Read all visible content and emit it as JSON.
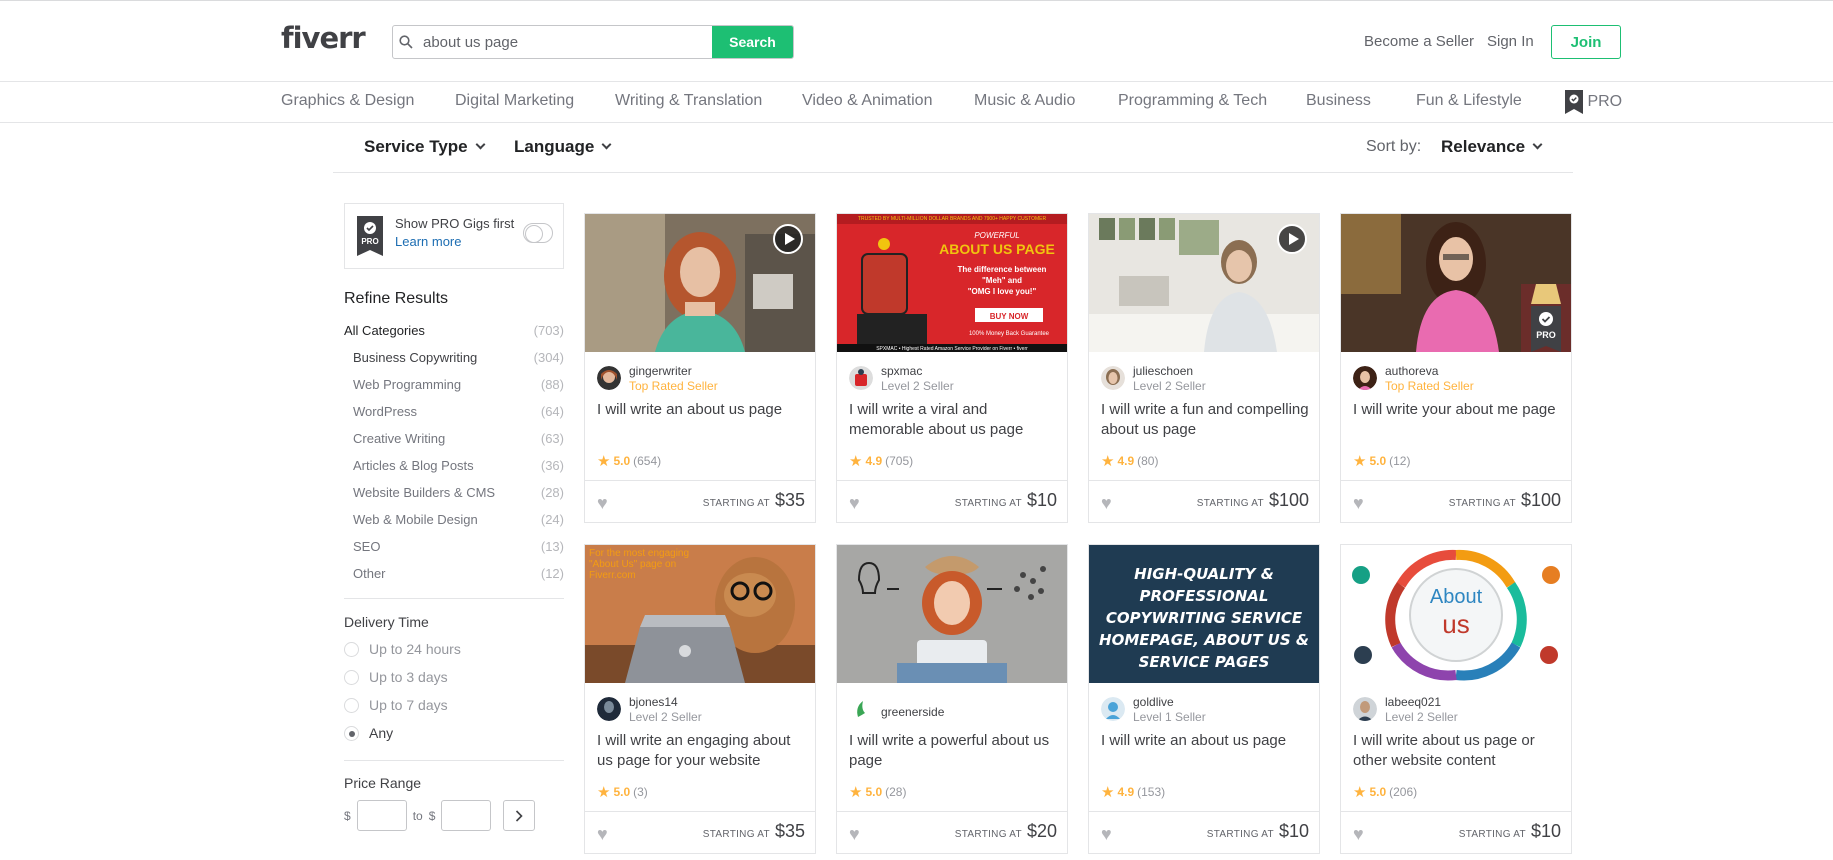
{
  "header": {
    "logo": "fiverr",
    "search_value": "about us page",
    "search_button": "Search",
    "become_seller": "Become a Seller",
    "sign_in": "Sign In",
    "join": "Join"
  },
  "categories": [
    "Graphics & Design",
    "Digital Marketing",
    "Writing & Translation",
    "Video & Animation",
    "Music & Audio",
    "Programming & Tech",
    "Business",
    "Fun & Lifestyle",
    "PRO"
  ],
  "filters": {
    "service_type": "Service Type",
    "language": "Language",
    "sort_label": "Sort by:",
    "sort_value": "Relevance"
  },
  "sidebar": {
    "pro_box": {
      "title": "Show PRO Gigs first",
      "link": "Learn more",
      "badge": "PRO"
    },
    "refine_title": "Refine Results",
    "all_categories": {
      "label": "All Categories",
      "count": "(703)"
    },
    "subcategories": [
      {
        "label": "Business Copywriting",
        "count": "(304)"
      },
      {
        "label": "Web Programming",
        "count": "(88)"
      },
      {
        "label": "WordPress",
        "count": "(64)"
      },
      {
        "label": "Creative Writing",
        "count": "(63)"
      },
      {
        "label": "Articles & Blog Posts",
        "count": "(36)"
      },
      {
        "label": "Website Builders & CMS",
        "count": "(28)"
      },
      {
        "label": "Web & Mobile Design",
        "count": "(24)"
      },
      {
        "label": "SEO",
        "count": "(13)"
      },
      {
        "label": "Other",
        "count": "(12)"
      }
    ],
    "delivery_title": "Delivery Time",
    "delivery_options": [
      "Up to 24 hours",
      "Up to 3 days",
      "Up to 7 days",
      "Any"
    ],
    "delivery_selected": "Any",
    "price_title": "Price Range",
    "price_from_symbol": "$",
    "price_to_label": "to",
    "price_to_symbol": "$"
  },
  "gigs": [
    {
      "seller": "gingerwriter",
      "level": "Top Rated Seller",
      "title": "I will write an about us page",
      "rating": "5.0",
      "reviews": "(654)",
      "price_label": "STARTING AT",
      "price": "$35"
    },
    {
      "seller": "spxmac",
      "level": "Level 2 Seller",
      "title": "I will write a viral and memorable about us page",
      "rating": "4.9",
      "reviews": "(705)",
      "price_label": "STARTING AT",
      "price": "$10"
    },
    {
      "seller": "julieschoen",
      "level": "Level 2 Seller",
      "title": "I will write a fun and compelling about us page",
      "rating": "4.9",
      "reviews": "(80)",
      "price_label": "STARTING AT",
      "price": "$100"
    },
    {
      "seller": "authoreva",
      "level": "Top Rated Seller",
      "title": "I will write your about me page",
      "rating": "5.0",
      "reviews": "(12)",
      "price_label": "STARTING AT",
      "price": "$100"
    },
    {
      "seller": "bjones14",
      "level": "Level 2 Seller",
      "title": "I will write an engaging about us page for your website",
      "rating": "5.0",
      "reviews": "(3)",
      "price_label": "STARTING AT",
      "price": "$35"
    },
    {
      "seller": "greenerside",
      "level": "",
      "title": "I will write a powerful about us page",
      "rating": "5.0",
      "reviews": "(28)",
      "price_label": "STARTING AT",
      "price": "$20"
    },
    {
      "seller": "goldlive",
      "level": "Level 1 Seller",
      "title": "I will write an about us page",
      "rating": "4.9",
      "reviews": "(153)",
      "price_label": "STARTING AT",
      "price": "$10"
    },
    {
      "seller": "labeeq021",
      "level": "Level 2 Seller",
      "title": "I will write about us page or other website content",
      "rating": "5.0",
      "reviews": "(206)",
      "price_label": "STARTING AT",
      "price": "$10"
    }
  ],
  "thumb_text": {
    "spxmac_top": "TRUSTED BY MULTI-MILLION DOLLAR BRANDS AND 7900+ HAPPY CUSTOMER",
    "spxmac_powerful": "POWERFUL",
    "spxmac_about": "ABOUT US PAGE",
    "spxmac_diff1": "The difference between",
    "spxmac_diff2": "\"Meh\" and",
    "spxmac_diff3": "\"OMG I love you!\"",
    "spxmac_buy": "BUY NOW",
    "spxmac_guarantee": "100% Money Back Guarantee",
    "spxmac_footer": "SPXMAC • Highest Rated Amazon Service Provider on Fiverr • fiverr",
    "bjones_overlay": "For the most engaging \"About Us\" page on Fiverr.com",
    "goldlive_text": "HIGH-QUALITY & PROFESSIONAL COPYWRITING SERVICE HOMEPAGE, ABOUT US & SERVICE PAGES",
    "labeeq_about": "About",
    "labeeq_us": "us"
  },
  "colors": {
    "brand_green": "#1dbf73",
    "star": "#ffb33e",
    "link_blue": "#1c6db2"
  }
}
